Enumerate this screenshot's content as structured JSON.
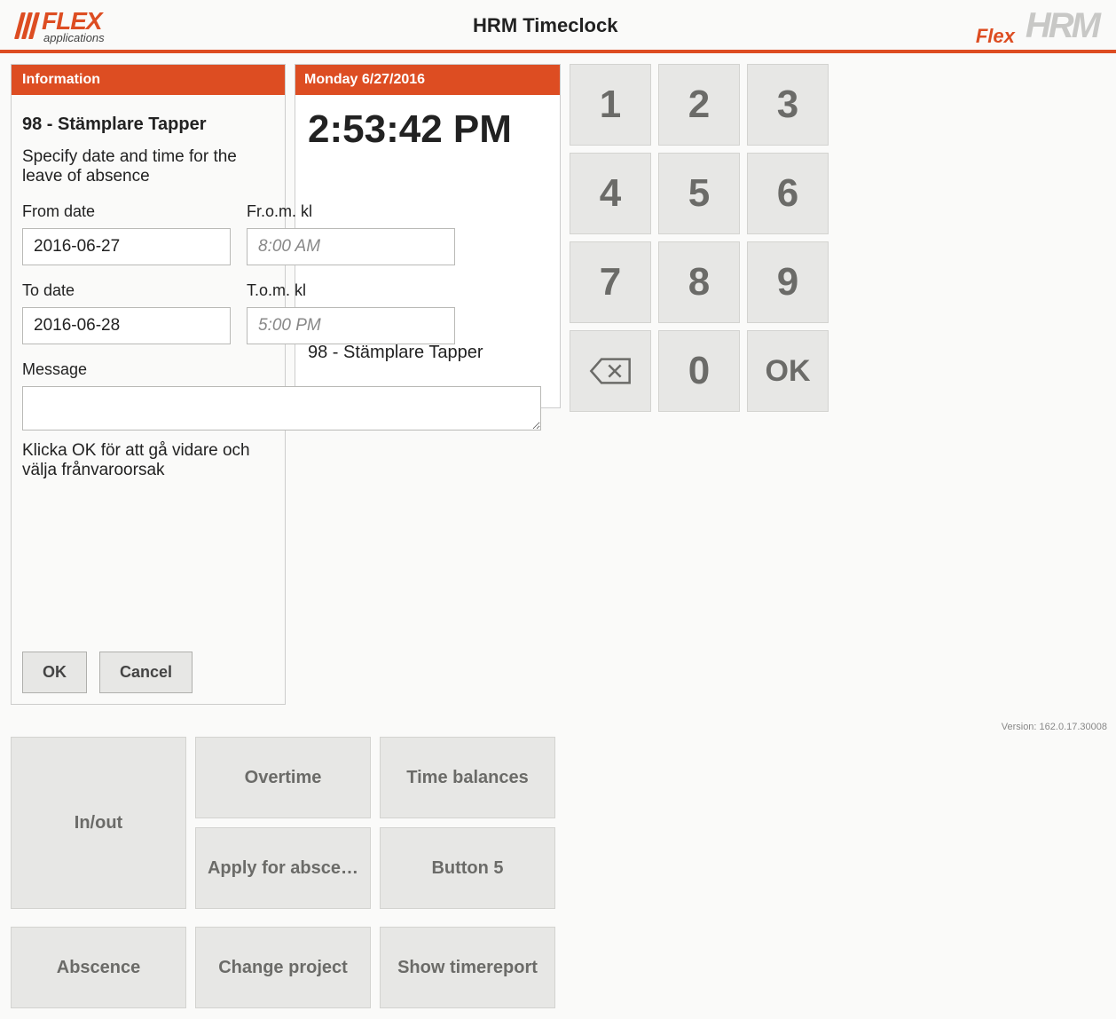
{
  "header": {
    "logo_brand": "FLEX",
    "logo_sub": "applications",
    "title": "HRM Timeclock",
    "right_flex": "Flex",
    "right_hrm": "HRM"
  },
  "clock": {
    "date": "Monday 6/27/2016",
    "time": "2:53:42 PM",
    "user": "98 - Stämplare Tapper"
  },
  "keypad": {
    "k1": "1",
    "k2": "2",
    "k3": "3",
    "k4": "4",
    "k5": "5",
    "k6": "6",
    "k7": "7",
    "k8": "8",
    "k9": "9",
    "k0": "0",
    "ok": "OK"
  },
  "buttons": {
    "inout": "In/out",
    "overtime": "Overtime",
    "timebal": "Time balances",
    "apply": "Apply for absce…",
    "button5": "Button 5",
    "abscence": "Abscence",
    "chgproj": "Change project",
    "showtime": "Show timereport"
  },
  "info": {
    "header": "Information",
    "user": "98 - Stämplare Tapper",
    "instruction": "Specify date and time for the leave of absence",
    "from_label": "From date",
    "fromtime_label": "Fr.o.m. kl",
    "to_label": "To date",
    "totime_label": "T.o.m. kl",
    "from_value": "2016-06-27",
    "fromtime_placeholder": "8:00 AM",
    "to_value": "2016-06-28",
    "totime_placeholder": "5:00 PM",
    "msg_label": "Message",
    "hint": "Klicka OK för att gå vidare och välja frånvaroorsak",
    "ok": "OK",
    "cancel": "Cancel"
  },
  "footer": {
    "version": "Version: 162.0.17.30008"
  }
}
